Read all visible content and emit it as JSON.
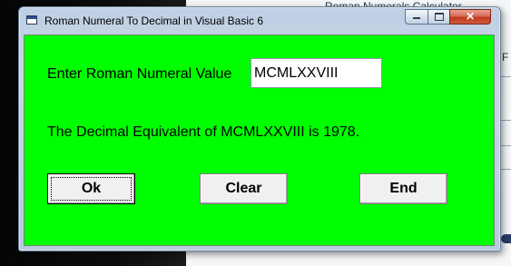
{
  "background": {
    "behind_window_title": "Roman Numerals Calculator",
    "partial_text": "o F"
  },
  "window": {
    "title": "Roman Numeral To Decimal in Visual Basic 6",
    "controls": {
      "close_label": "✕"
    }
  },
  "form": {
    "prompt_label": "Enter Roman Numeral Value",
    "input_value": "MCMLXXVIII",
    "result_text": "The Decimal Equivalent of MCMLXXVIII is 1978.",
    "background_color": "#00ff00"
  },
  "buttons": {
    "ok_label": "Ok",
    "clear_label": "Clear",
    "end_label": "End"
  }
}
